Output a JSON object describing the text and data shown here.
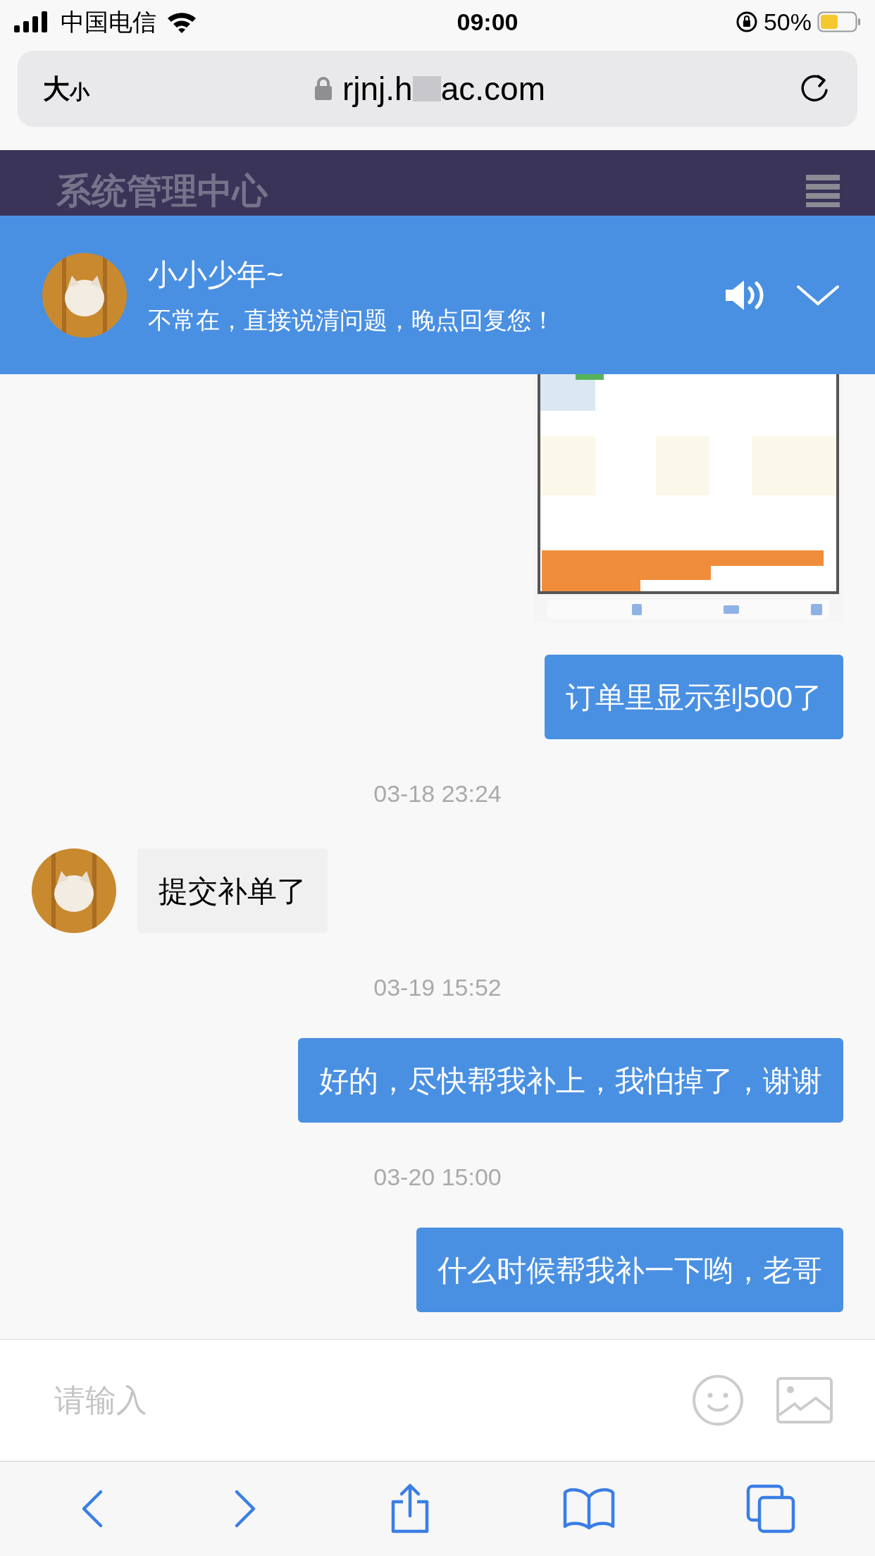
{
  "status_bar": {
    "carrier": "中国电信",
    "time": "09:00",
    "battery": "50%"
  },
  "address_bar": {
    "size_big": "大",
    "size_small": "小",
    "url_start": "rjnj.h",
    "url_end": "ac.com"
  },
  "page_header": {
    "title": "系统管理中心"
  },
  "chat_header": {
    "name": "小小少年~",
    "status": "不常在，直接说清问题，晚点回复您！"
  },
  "messages": [
    {
      "kind": "picture"
    },
    {
      "kind": "text",
      "mine": true,
      "text": "订单里显示到500了"
    },
    {
      "kind": "time",
      "text": "03-18 23:24"
    },
    {
      "kind": "text",
      "mine": false,
      "text": "提交补单了"
    },
    {
      "kind": "time",
      "text": "03-19 15:52"
    },
    {
      "kind": "text",
      "mine": true,
      "text": "好的，尽快帮我补上，我怕掉了，谢谢"
    },
    {
      "kind": "time",
      "text": "03-20 15:00"
    },
    {
      "kind": "text",
      "mine": true,
      "text": "什么时候帮我补一下哟，老哥"
    }
  ],
  "composer": {
    "placeholder": "请输入"
  }
}
